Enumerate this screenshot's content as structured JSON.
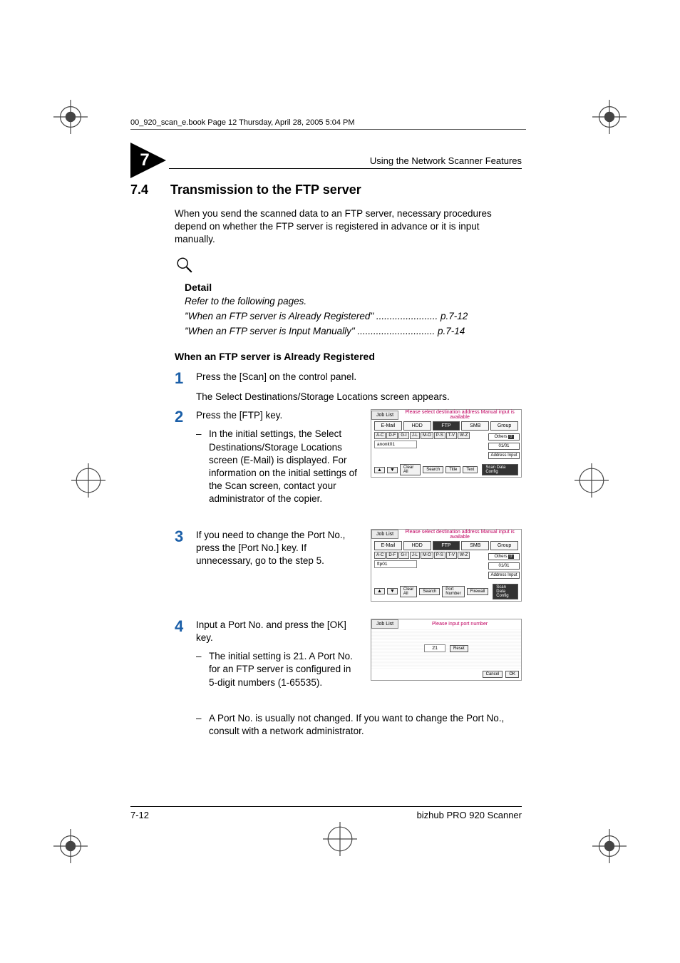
{
  "page_header_line": "00_920_scan_e.book  Page 12  Thursday, April 28, 2005  5:04 PM",
  "chapter_number": "7",
  "running_header": "Using the Network Scanner Features",
  "section_number": "7.4",
  "section_title": "Transmission to the FTP server",
  "intro_paragraph": "When you send the scanned data to an FTP server, necessary procedures depend on whether the FTP server is registered in advance or it is input manually.",
  "detail": {
    "label": "Detail",
    "refer": "Refer to the following pages.",
    "ref1": "\"When an FTP server is Already Registered\" ....................... p.7-12",
    "ref2": "\"When an FTP server is Input Manually\" ............................. p.7-14"
  },
  "subheading": "When an FTP server is Already Registered",
  "steps": {
    "s1": {
      "num": "1",
      "line1": "Press the [Scan] on the control panel.",
      "line2": "The Select Destinations/Storage Locations screen appears."
    },
    "s2": {
      "num": "2",
      "line1": "Press the [FTP] key.",
      "bullet": "In the initial settings, the Select Destinations/Storage Locations screen (E-Mail) is displayed. For information on the initial settings of the Scan screen, contact your administrator of the copier."
    },
    "s3": {
      "num": "3",
      "line1": "If you need to change the Port No., press the [Port No.] key. If unnecessary, go to the step 5."
    },
    "s4": {
      "num": "4",
      "line1": "Input a Port No. and press the [OK] key.",
      "bullet1": "The initial setting is 21. A Port No. for an FTP server is configured in 5-digit numbers (1-65535).",
      "bullet2": "A Port No. is usually not changed. If you want to change the Port No., consult with a network administrator."
    }
  },
  "figures": {
    "fig1": {
      "job_list": "Job List",
      "msg": "Please select destination address Manual input is available",
      "tabs": [
        "E-Mail",
        "HDD",
        "FTP",
        "SMB",
        "Group"
      ],
      "selected_tab": "FTP",
      "abc": [
        "A-C",
        "D-F",
        "G-I",
        "J-L",
        "M-O",
        "P-S",
        "T-V",
        "W-Z"
      ],
      "list_item": "anonit01",
      "side": {
        "others": "Others",
        "count": "01/01",
        "addr": "Address Input"
      },
      "bottom": {
        "up": "▲",
        "down": "▼",
        "clear": "Clear All",
        "search": "Search",
        "title": "Title",
        "text": "Text",
        "scan": "Scan Data Config"
      }
    },
    "fig2": {
      "job_list": "Job List",
      "msg": "Please select destination address Manual input is available",
      "tabs": [
        "E-Mail",
        "HDD",
        "FTP",
        "SMB",
        "Group"
      ],
      "selected_tab": "FTP",
      "abc": [
        "A-C",
        "D-F",
        "G-I",
        "J-L",
        "M-O",
        "P-S",
        "T-V",
        "W-Z"
      ],
      "list_item": "ftp01",
      "side": {
        "others": "Others",
        "count": "01/01",
        "addr": "Address Input"
      },
      "bottom": {
        "up": "▲",
        "down": "▼",
        "clear": "Clear All",
        "search": "Search",
        "portno": "Port Number",
        "firewall": "Firewall",
        "scan": "Scan Data Config"
      }
    },
    "fig3": {
      "job_list": "Job List",
      "msg": "Please input port number",
      "value": "21",
      "reset": "Reset",
      "cancel": "Cancel",
      "ok": "OK"
    }
  },
  "footer": {
    "page": "7-12",
    "product": "bizhub PRO 920 Scanner"
  }
}
